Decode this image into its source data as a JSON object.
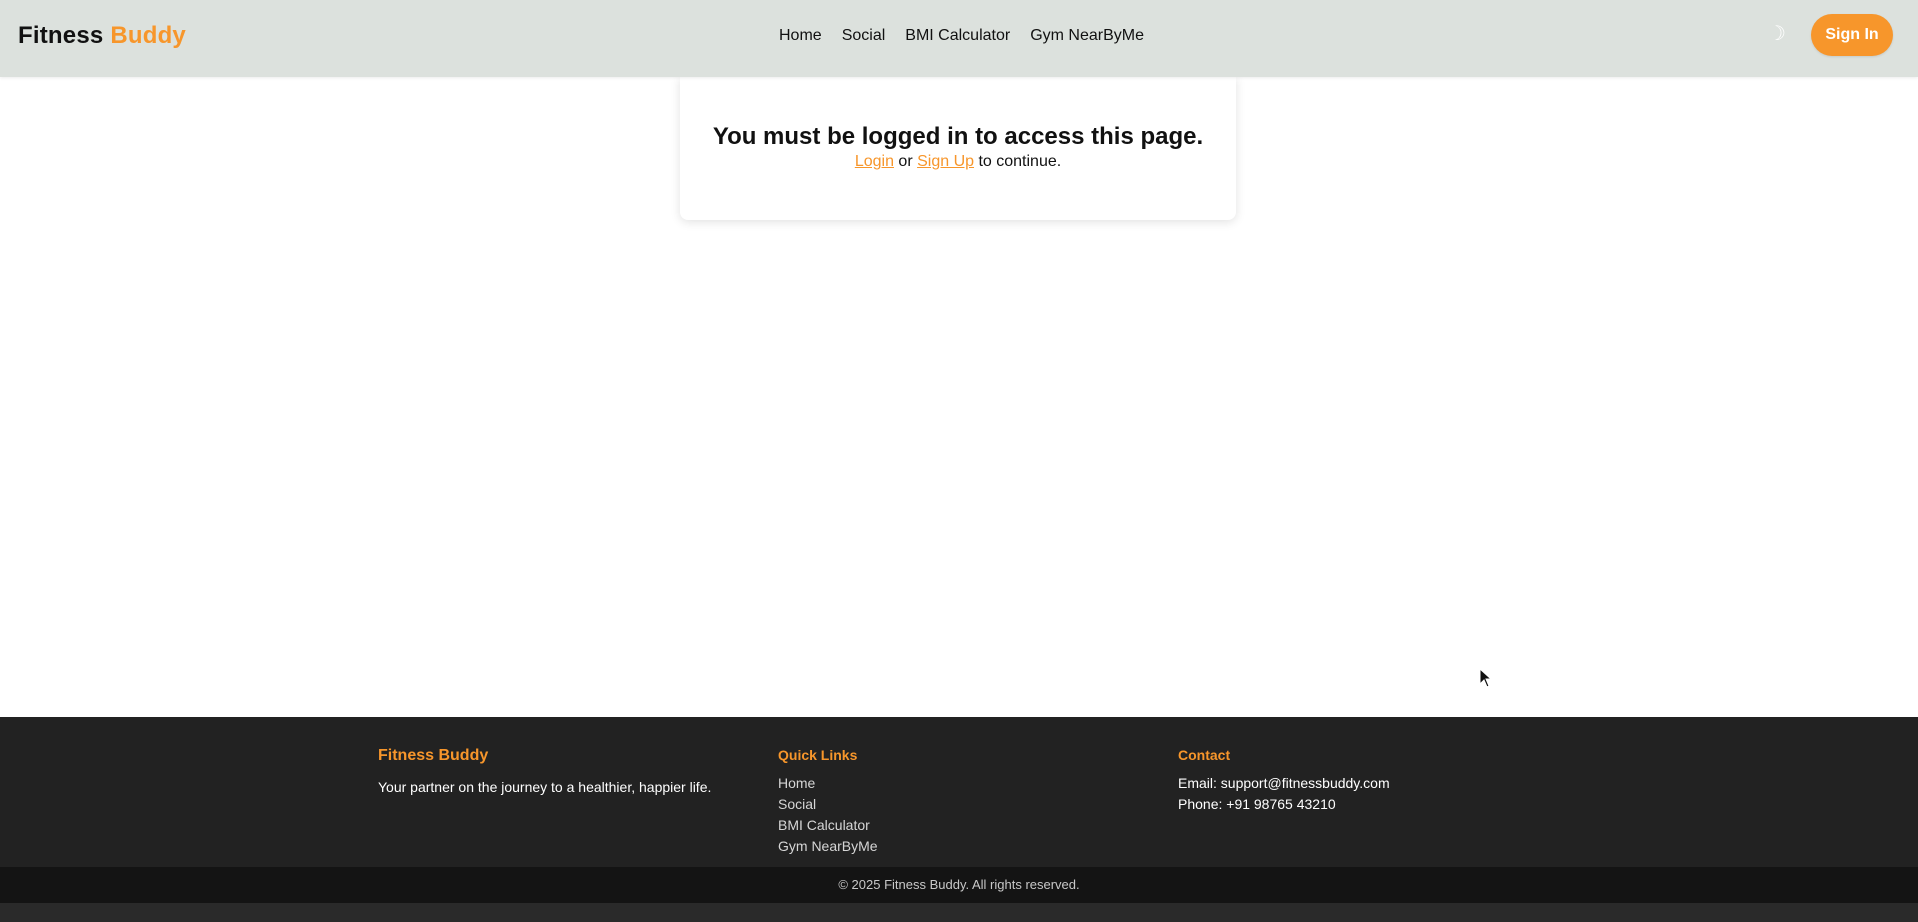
{
  "navbar": {
    "brand_part1": "Fitness",
    "brand_part2": "Buddy",
    "links": [
      "Home",
      "Social",
      "BMI Calculator",
      "Gym NearByMe"
    ],
    "theme_icon": "☽",
    "signin_label": "Sign In"
  },
  "main": {
    "heading": "You must be logged in to access this page.",
    "login_link": "Login",
    "or_text": " or ",
    "signup_link": "Sign Up",
    "continue_text": " to continue."
  },
  "footer": {
    "brand_title": "Fitness Buddy",
    "tagline": "Your partner on the journey to a healthier, happier life.",
    "quick_links_title": "Quick Links",
    "quick_links": [
      "Home",
      "Social",
      "BMI Calculator",
      "Gym NearByMe"
    ],
    "contact_title": "Contact",
    "email_line": "Email: support@fitnessbuddy.com",
    "phone_line": "Phone: +91 98765 43210",
    "copyright": "© 2025 Fitness Buddy. All rights reserved."
  },
  "colors": {
    "accent": "#f7962b",
    "navbar_bg": "#dce1dd",
    "footer_bg": "#222222",
    "copyright_bg": "#141414"
  },
  "icons": {
    "theme_toggle": "moon-icon",
    "cursor": "mouse-pointer-icon"
  }
}
